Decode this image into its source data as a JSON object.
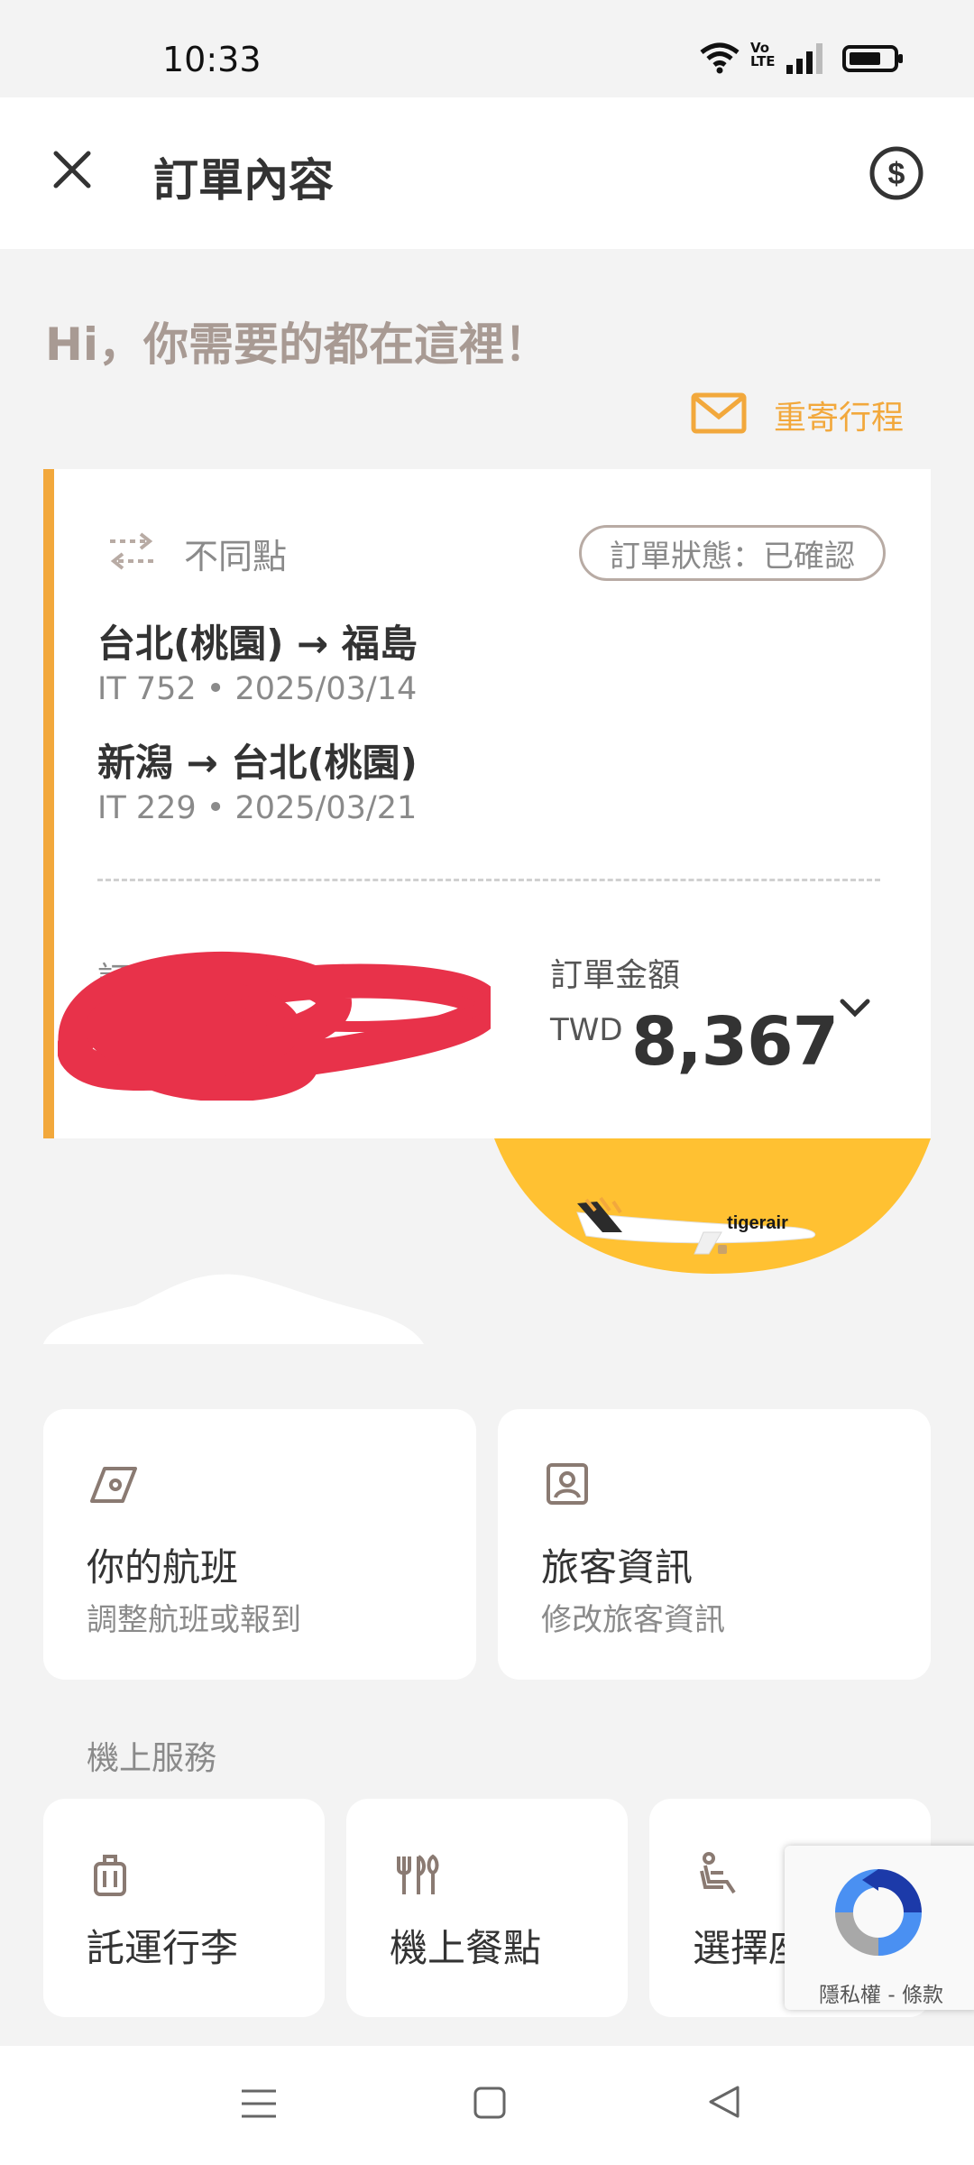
{
  "status_bar": {
    "time": "10:33",
    "network": "Vo\nLTE"
  },
  "header": {
    "title": "訂單內容"
  },
  "greeting": "Hi，你需要的都在這裡！",
  "resend": {
    "label": "重寄行程"
  },
  "order": {
    "trip_type": "不同點",
    "status": "訂單狀態：已確認",
    "flights": [
      {
        "route": "台北(桃園) → 福島",
        "info": "IT 752 • 2025/03/14"
      },
      {
        "route": "新潟 → 台北(桃園)",
        "info": "IT 229 • 2025/03/21"
      }
    ],
    "order_no_label": "訂",
    "amount_label": "訂單金額",
    "currency": "TWD",
    "amount": "8,367"
  },
  "services": {
    "tiles": [
      {
        "title": "你的航班",
        "subtitle": "調整航班或報到"
      },
      {
        "title": "旅客資訊",
        "subtitle": "修改旅客資訊"
      }
    ],
    "section_label": "機上服務",
    "onboard": [
      {
        "title": "託運行李"
      },
      {
        "title": "機上餐點"
      },
      {
        "title": "選擇座位"
      }
    ]
  },
  "plane_brand": "tigerair",
  "recaptcha": {
    "text": "隱私權 - 條款"
  },
  "colors": {
    "accent": "#f2a83c",
    "sun": "#ffc132",
    "redaction": "#e8324a"
  }
}
